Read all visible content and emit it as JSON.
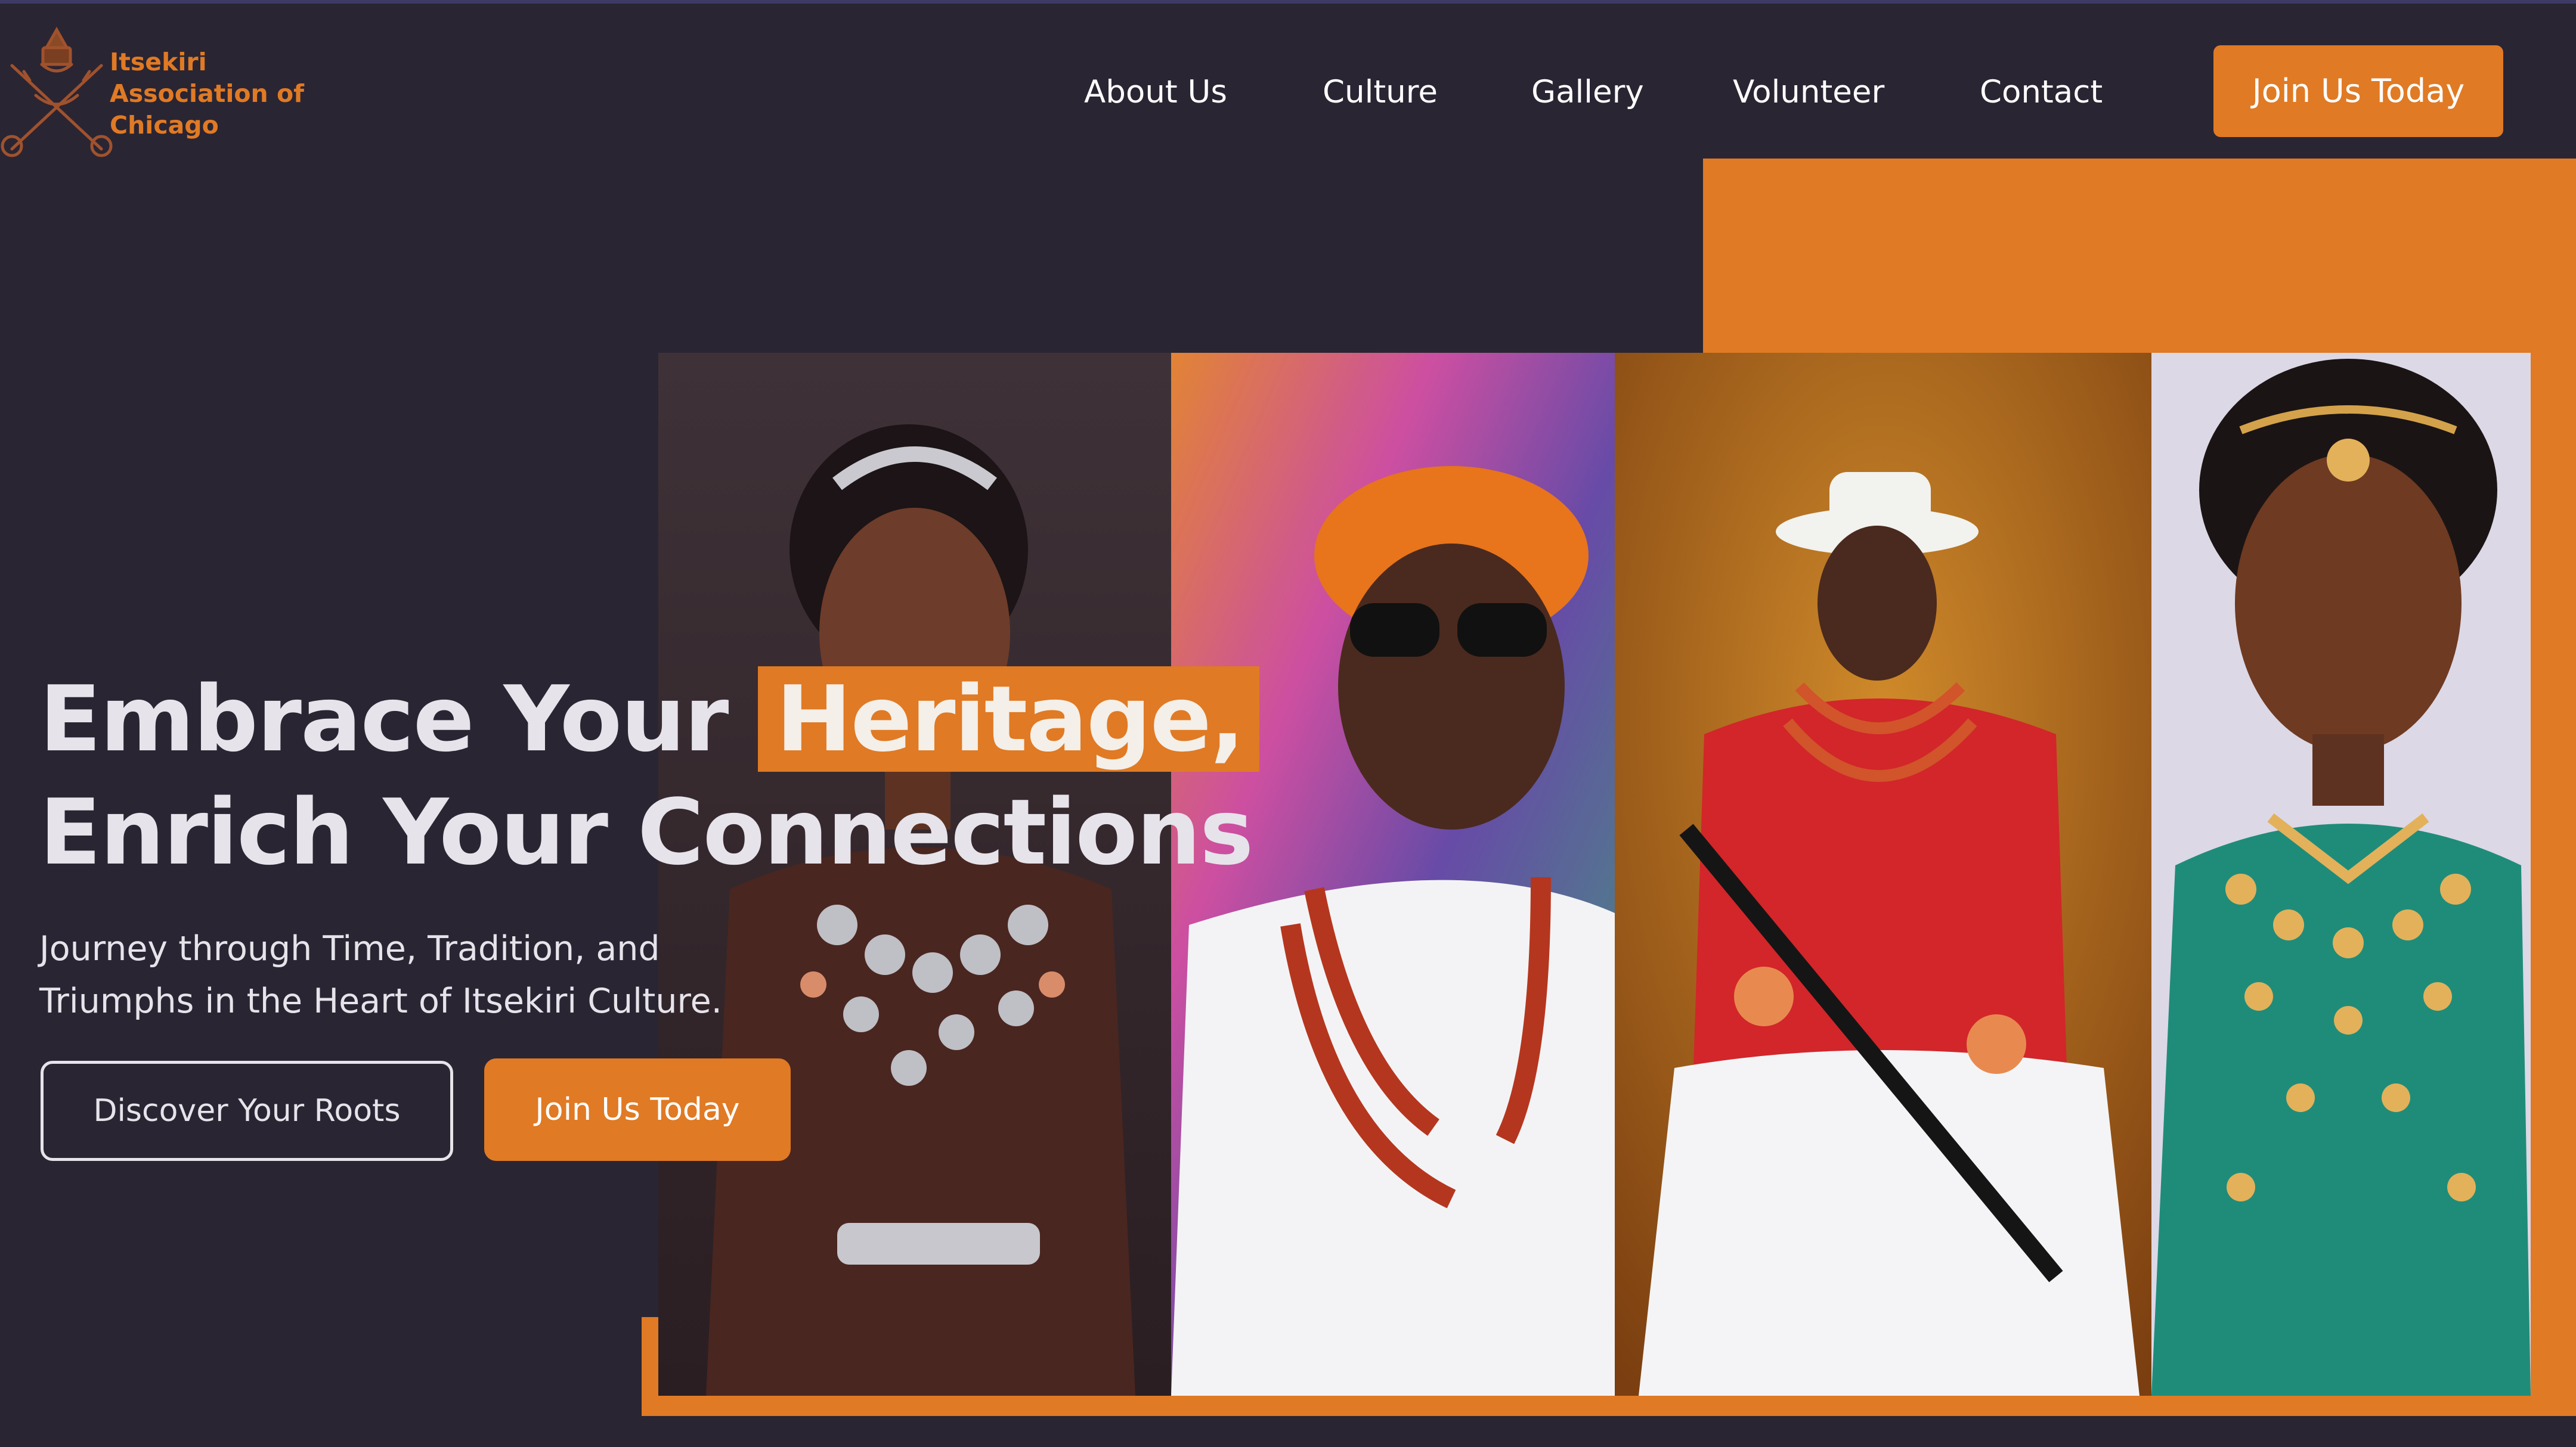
{
  "brand": {
    "name_lines": [
      "Itsekiri",
      "Association of",
      "Chicago"
    ],
    "emblem_icon": "crossed-swords-crest-icon",
    "color": "#e07a24"
  },
  "nav": {
    "links": [
      "About Us",
      "Culture",
      "Gallery",
      "Volunteer",
      "Contact"
    ],
    "cta": "Join Us Today"
  },
  "hero": {
    "title_line1_prefix": "Embrace Your",
    "title_line1_highlight": "Heritage,",
    "title_line2": "Enrich Your Connections",
    "subtitle_lines": [
      "Journey through Time, Tradition, and",
      "Triumphs in the Heart of Itsekiri Culture."
    ],
    "primary_button": "Discover Your Roots",
    "secondary_button": "Join Us Today"
  },
  "gallery": {
    "photos": [
      "woman-in-silver-coral-regalia-photo",
      "man-in-orange-cap-and-sunglasses-photo",
      "man-in-red-shirt-with-staff-photo",
      "woman-in-gold-beads-and-green-wrapper-photo"
    ]
  },
  "colors": {
    "background": "#2a2533",
    "accent": "#e07a24",
    "text": "#e6e3ea"
  }
}
